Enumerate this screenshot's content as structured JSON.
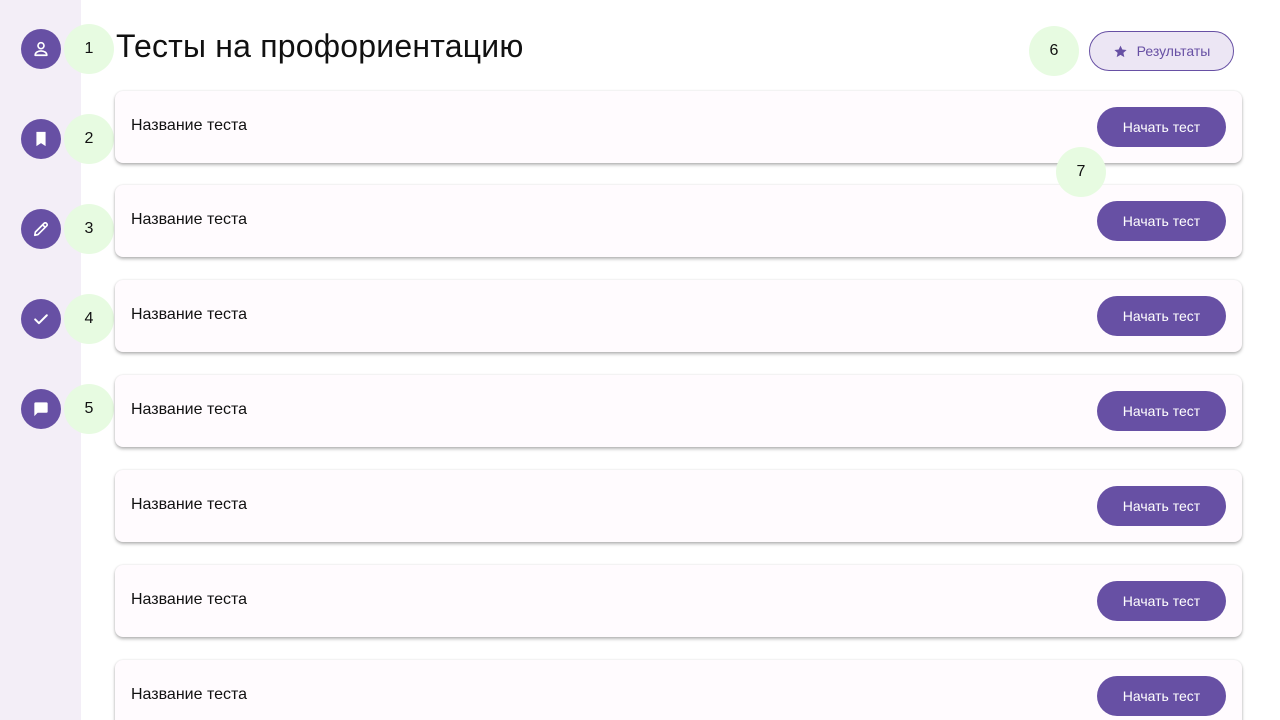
{
  "header": {
    "title": "Тесты на профориентацию",
    "results_label": "Результаты",
    "results_icon": "star-icon"
  },
  "sidebar": {
    "items": [
      {
        "icon": "person-icon",
        "marker": "1"
      },
      {
        "icon": "bookmark-icon",
        "marker": "2"
      },
      {
        "icon": "pencil-icon",
        "marker": "3"
      },
      {
        "icon": "check-icon",
        "marker": "4"
      },
      {
        "icon": "chat-icon",
        "marker": "5"
      }
    ]
  },
  "markers": {
    "results": "6",
    "first_test": "7"
  },
  "tests": [
    {
      "name": "Название теста",
      "button": "Начать тест"
    },
    {
      "name": "Название теста",
      "button": "Начать тест"
    },
    {
      "name": "Название теста",
      "button": "Начать тест"
    },
    {
      "name": "Название теста",
      "button": "Начать тест"
    },
    {
      "name": "Название теста",
      "button": "Начать тест"
    },
    {
      "name": "Название теста",
      "button": "Начать тест"
    },
    {
      "name": "Название теста",
      "button": "Начать тест"
    }
  ],
  "colors": {
    "accent": "#6750a4",
    "sidebar_bg": "#f3eef7",
    "card_bg": "#fffbfe",
    "marker_bg": "#e7fbe1"
  }
}
